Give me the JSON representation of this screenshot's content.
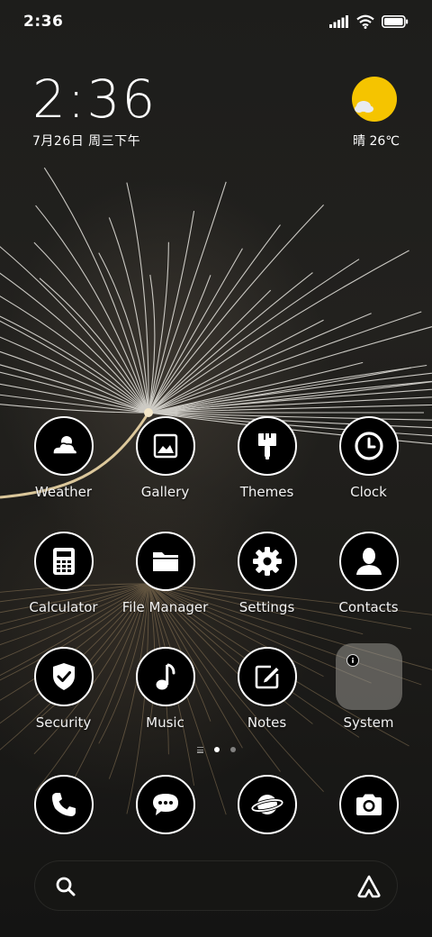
{
  "status_bar": {
    "time": "2:36"
  },
  "clock_widget": {
    "time": "2:36",
    "date": "7月26日 周三下午"
  },
  "weather_widget": {
    "label": "晴 26℃"
  },
  "apps": [
    {
      "label": "Weather",
      "icon": "weather-icon"
    },
    {
      "label": "Gallery",
      "icon": "gallery-icon"
    },
    {
      "label": "Themes",
      "icon": "brush-icon"
    },
    {
      "label": "Clock",
      "icon": "clock-icon"
    },
    {
      "label": "Calculator",
      "icon": "calculator-icon"
    },
    {
      "label": "File Manager",
      "icon": "folder-icon"
    },
    {
      "label": "Settings",
      "icon": "gear-icon"
    },
    {
      "label": "Contacts",
      "icon": "person-icon"
    },
    {
      "label": "Security",
      "icon": "shield-icon"
    },
    {
      "label": "Music",
      "icon": "music-note-icon"
    },
    {
      "label": "Notes",
      "icon": "pencil-icon"
    },
    {
      "label": "System",
      "icon": "folder-group-icon"
    }
  ],
  "dock": [
    {
      "icon": "phone-icon"
    },
    {
      "icon": "chat-bubble-icon"
    },
    {
      "icon": "planet-icon"
    },
    {
      "icon": "camera-icon"
    }
  ],
  "page_indicator": {
    "pages": 2,
    "active": 1
  },
  "colors": {
    "sun": "#f5c400",
    "icon_bg": "#000000",
    "icon_border": "#ffffff"
  }
}
